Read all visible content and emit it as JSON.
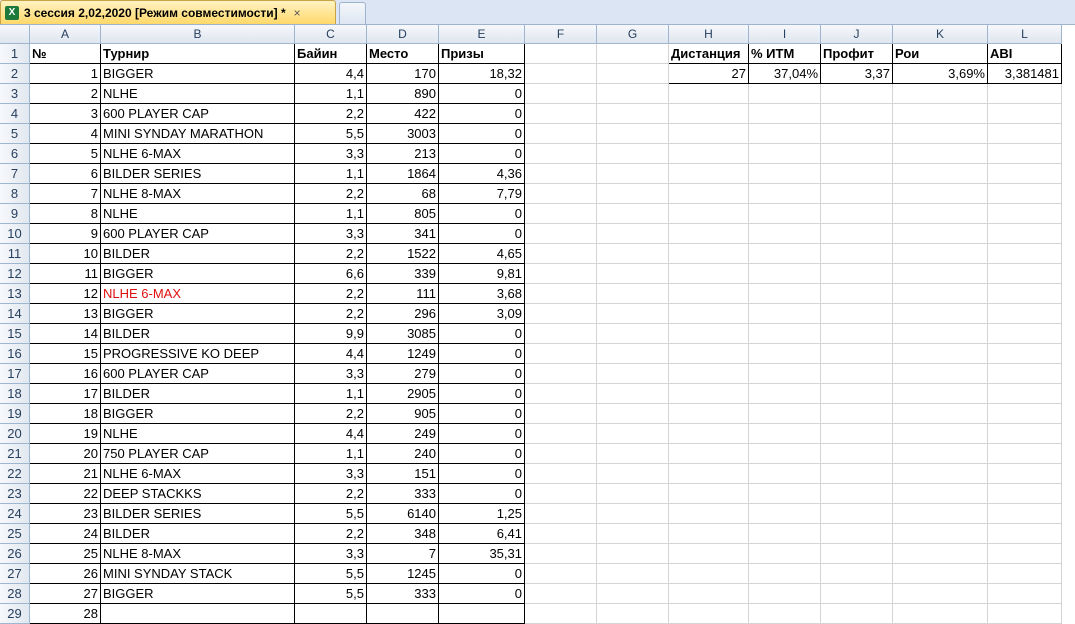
{
  "window": {
    "tab_title": "3 сессия 2,02,2020  [Режим совместимости]  *",
    "tab_close": "×",
    "app_icon": "excel-icon"
  },
  "columns": [
    "A",
    "B",
    "C",
    "D",
    "E",
    "F",
    "G",
    "H",
    "I",
    "J",
    "K",
    "L"
  ],
  "row_numbers": [
    "1",
    "2",
    "3",
    "4",
    "5",
    "6",
    "7",
    "8",
    "9",
    "10",
    "11",
    "12",
    "13",
    "14",
    "15",
    "16",
    "17",
    "18",
    "19",
    "20",
    "21",
    "22",
    "23",
    "24",
    "25",
    "26",
    "27",
    "28",
    "29"
  ],
  "headers": {
    "A": "№",
    "B": "Турнир",
    "C": "Байин",
    "D": "Место",
    "E": "Призы",
    "H": "Дистанция",
    "I": "% ИТМ",
    "J": "Профит",
    "K": "Рои",
    "L": "ABI"
  },
  "summary": {
    "H": "27",
    "I": "37,04%",
    "J": "3,37",
    "K": "3,69%",
    "L": "3,381481"
  },
  "accent_red": "#e01010",
  "rows": [
    [
      "1",
      "BIGGER",
      "4,4",
      "170",
      "18,32"
    ],
    [
      "2",
      "NLHE",
      "1,1",
      "890",
      "0"
    ],
    [
      "3",
      "600 PLAYER CAP",
      "2,2",
      "422",
      "0"
    ],
    [
      "4",
      "MINI SYNDAY MARATHON",
      "5,5",
      "3003",
      "0"
    ],
    [
      "5",
      "NLHE 6-MAX",
      "3,3",
      "213",
      "0"
    ],
    [
      "6",
      "BILDER SERIES",
      "1,1",
      "1864",
      "4,36"
    ],
    [
      "7",
      "NLHE 8-MAX",
      "2,2",
      "68",
      "7,79"
    ],
    [
      "8",
      "NLHE",
      "1,1",
      "805",
      "0"
    ],
    [
      "9",
      "600 PLAYER CAP",
      "3,3",
      "341",
      "0"
    ],
    [
      "10",
      "BILDER",
      "2,2",
      "1522",
      "4,65"
    ],
    [
      "11",
      "BIGGER",
      "6,6",
      "339",
      "9,81"
    ],
    [
      "12",
      "NLHE 6-MAX",
      "2,2",
      "111",
      "3,68"
    ],
    [
      "13",
      "BIGGER",
      "2,2",
      "296",
      "3,09"
    ],
    [
      "14",
      "BILDER",
      "9,9",
      "3085",
      "0"
    ],
    [
      "15",
      "PROGRESSIVE KO DEEP",
      "4,4",
      "1249",
      "0"
    ],
    [
      "16",
      "600 PLAYER CAP",
      "3,3",
      "279",
      "0"
    ],
    [
      "17",
      "BILDER",
      "1,1",
      "2905",
      "0"
    ],
    [
      "18",
      "BIGGER",
      "2,2",
      "905",
      "0"
    ],
    [
      "19",
      "NLHE",
      "4,4",
      "249",
      "0"
    ],
    [
      "20",
      "750 PLAYER CAP",
      "1,1",
      "240",
      "0"
    ],
    [
      "21",
      "NLHE 6-MAX",
      "3,3",
      "151",
      "0"
    ],
    [
      "22",
      "DEEP STACKKS",
      "2,2",
      "333",
      "0"
    ],
    [
      "23",
      "BILDER SERIES",
      "5,5",
      "6140",
      "1,25"
    ],
    [
      "24",
      "BILDER",
      "2,2",
      "348",
      "6,41"
    ],
    [
      "25",
      "NLHE 8-MAX",
      "3,3",
      "7",
      "35,31"
    ],
    [
      "26",
      "MINI SYNDAY STACK",
      "5,5",
      "1245",
      "0"
    ],
    [
      "27",
      "BIGGER",
      "5,5",
      "333",
      "0"
    ],
    [
      "28",
      "",
      "",
      "",
      ""
    ]
  ]
}
